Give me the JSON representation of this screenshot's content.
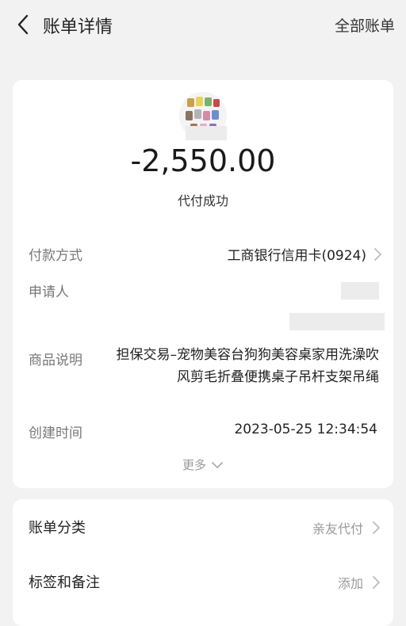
{
  "header": {
    "title": "账单详情",
    "action_label": "全部账单"
  },
  "summary": {
    "amount": "-2,550.00",
    "status": "代付成功"
  },
  "details": {
    "payment_method_label": "付款方式",
    "payment_method_value": "工商银行信用卡(0924)",
    "applicant_label": "申请人",
    "product_label": "商品说明",
    "product_value": "担保交易–宠物美容台狗狗美容桌家用洗澡吹风剪毛折叠便携桌子吊杆支架吊绳",
    "created_label": "创建时间",
    "created_value": "2023-05-25 12:34:54",
    "more_label": "更多"
  },
  "extra": {
    "category_label": "账单分类",
    "category_value": "亲友代付",
    "tags_label": "标签和备注",
    "tags_value": "添加"
  }
}
